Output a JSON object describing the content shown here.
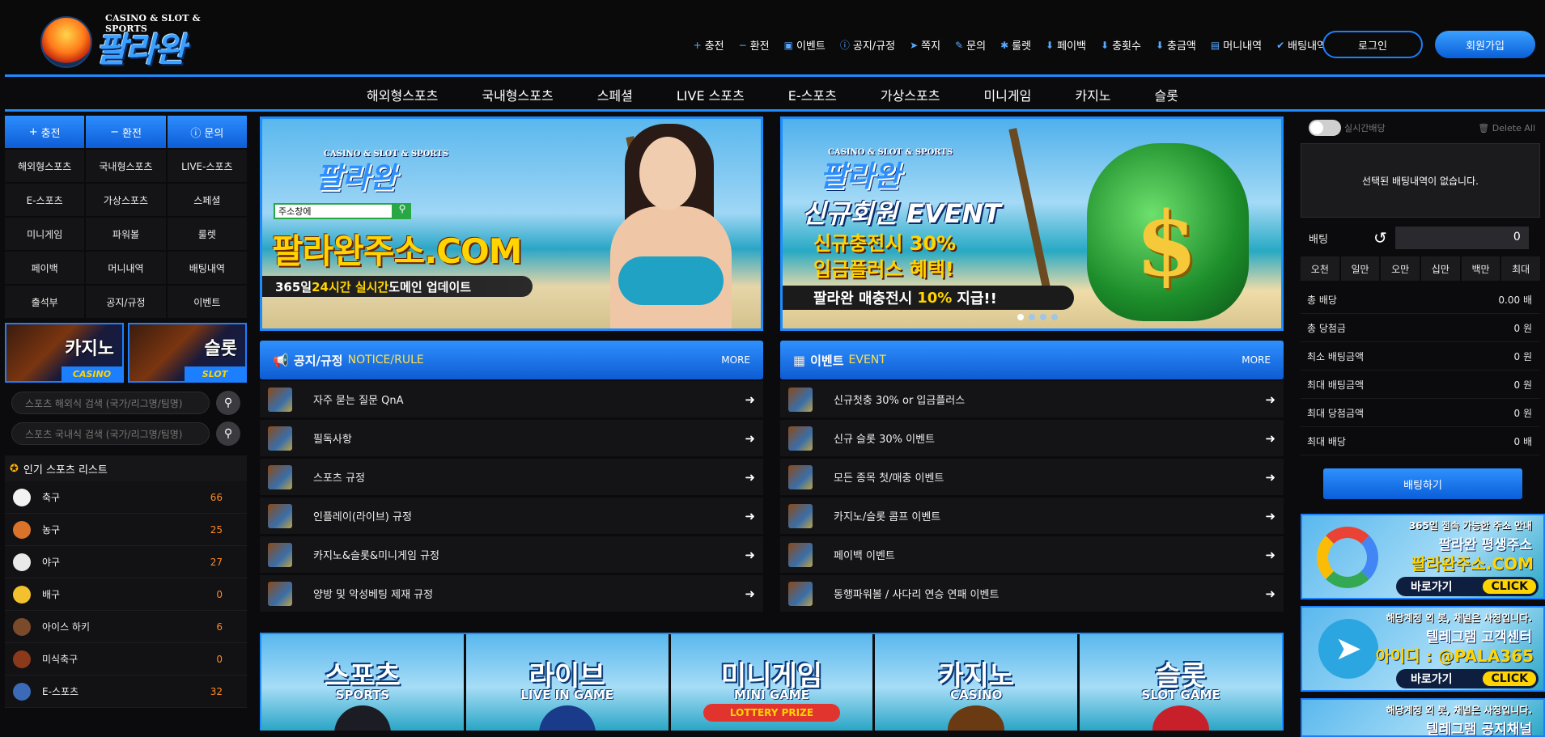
{
  "logo": {
    "small": "CASINO & SLOT & SPORTS",
    "big": "팔라완"
  },
  "topnav": [
    {
      "icon": "plus-icon",
      "glyph": "+",
      "label": "충전"
    },
    {
      "icon": "minus-icon",
      "glyph": "−",
      "label": "환전"
    },
    {
      "icon": "calendar-icon",
      "glyph": "▣",
      "label": "이벤트"
    },
    {
      "icon": "info-icon",
      "glyph": "ⓘ",
      "label": "공지/규정"
    },
    {
      "icon": "paper-plane-icon",
      "glyph": "➤",
      "label": "쪽지"
    },
    {
      "icon": "edit-icon",
      "glyph": "✎",
      "label": "문의"
    },
    {
      "icon": "gift-icon",
      "glyph": "✱",
      "label": "룰렛"
    },
    {
      "icon": "hand-coin-icon",
      "glyph": "⬇",
      "label": "페이백"
    },
    {
      "icon": "hand-coin-icon",
      "glyph": "⬇",
      "label": "충횟수"
    },
    {
      "icon": "hand-coin-icon",
      "glyph": "⬇",
      "label": "충금액"
    },
    {
      "icon": "wallet-icon",
      "glyph": "▤",
      "label": "머니내역"
    },
    {
      "icon": "check-icon",
      "glyph": "✔",
      "label": "배팅내역"
    }
  ],
  "auth": {
    "login": "로그인",
    "join": "회원가입"
  },
  "mainnav": [
    "해외형스포츠",
    "국내형스포츠",
    "스페셜",
    "LIVE 스포츠",
    "E-스포츠",
    "가상스포츠",
    "미니게임",
    "카지노",
    "슬롯"
  ],
  "sidebar": {
    "quick": [
      {
        "glyph": "+",
        "label": "충전"
      },
      {
        "glyph": "−",
        "label": "환전"
      },
      {
        "glyph": "ⓘ",
        "label": "문의"
      }
    ],
    "grid": [
      "해외형스포츠",
      "국내형스포츠",
      "LIVE-스포츠",
      "E-스포츠",
      "가상스포츠",
      "스페셜",
      "미니게임",
      "파워볼",
      "룰렛",
      "페이백",
      "머니내역",
      "배팅내역",
      "출석부",
      "공지/규정",
      "이벤트"
    ],
    "tiles": [
      {
        "title": "카지노",
        "tag": "CASINO"
      },
      {
        "title": "슬롯",
        "tag": "SLOT"
      }
    ],
    "search_overseas": "스포츠 해외식 검색 (국가/리그명/팀명)",
    "search_domestic": "스포츠 국내식 검색 (국가/리그명/팀명)",
    "popular_title": "인기 스포츠 리스트",
    "sports": [
      {
        "name": "축구",
        "count": "66",
        "color": "#f2f2f2"
      },
      {
        "name": "농구",
        "count": "25",
        "color": "#d9732a"
      },
      {
        "name": "야구",
        "count": "27",
        "color": "#e9e9e9"
      },
      {
        "name": "배구",
        "count": "0",
        "color": "#f3c02e"
      },
      {
        "name": "아이스 하키",
        "count": "6",
        "color": "#7a4a2a"
      },
      {
        "name": "미식축구",
        "count": "0",
        "color": "#8a3a1a"
      },
      {
        "name": "E-스포츠",
        "count": "32",
        "color": "#3a6ab8"
      }
    ]
  },
  "banner1": {
    "logo_small": "CASINO & SLOT & SPORTS",
    "logo_big": "팔라완",
    "addr": "주소창에",
    "site": "팔라완주소.COM",
    "strip_a": "365일 ",
    "strip_b": "24시간 실시간",
    "strip_c": " 도메인 업데이트"
  },
  "banner2": {
    "logo_small": "CASINO & SLOT & SPORTS",
    "logo_big": "팔라완",
    "event": "신규회원 EVENT",
    "line1": "신규충전시 30%",
    "line2": "입금플러스 혜택!",
    "strip_a": "팔라완 매충전시",
    "strip_b": "10%",
    "strip_c": "지급!!"
  },
  "notice": {
    "title": "공지/규정",
    "sub": "NOTICE/RULE",
    "more": "MORE",
    "items": [
      "자주 묻는 질문 QnA",
      "필독사항",
      "스포츠 규정",
      "인플레이(라이브) 규정",
      "카지노&슬롯&미니게임 규정",
      "양방 및 악성베팅 제재 규정"
    ]
  },
  "event": {
    "title": "이벤트",
    "sub": "EVENT",
    "more": "MORE",
    "items": [
      "신규첫충 30% or 입금플러스",
      "신규 슬롯 30% 이벤트",
      "모든 종목 첫/매충 이벤트",
      "카지노/슬롯 콤프 이벤트",
      "페이백 이벤트",
      "동행파워볼 / 사다리 연승 연패 이벤트"
    ]
  },
  "games": [
    {
      "kr": "스포츠",
      "en": "SPORTS"
    },
    {
      "kr": "라이브",
      "en": "LIVE IN GAME"
    },
    {
      "kr": "미니게임",
      "en": "MINI GAME",
      "extra": "LOTTERY PRIZE"
    },
    {
      "kr": "카지노",
      "en": "CASINO"
    },
    {
      "kr": "슬롯",
      "en": "SLOT GAME"
    }
  ],
  "betslip": {
    "realtime": "실시간배당",
    "delete_all": "Delete All",
    "empty": "선택된 배팅내역이 없습니다.",
    "bet_label": "배팅",
    "bet_value": "0",
    "amounts": [
      "오천",
      "일만",
      "오만",
      "십만",
      "백만",
      "최대"
    ],
    "stats": [
      {
        "k": "총 배당",
        "v": "0.00 배"
      },
      {
        "k": "총 당첨금",
        "v": "0 원"
      },
      {
        "k": "최소 배팅금액",
        "v": "0 원"
      },
      {
        "k": "최대 배팅금액",
        "v": "0 원"
      },
      {
        "k": "최대 당첨금액",
        "v": "0 원"
      },
      {
        "k": "최대 배당",
        "v": "0 배"
      }
    ],
    "bet_button": "배팅하기"
  },
  "ads": [
    {
      "l1": "365일 접속 가능한 주소 안내",
      "l2": "팔라완 평생주소",
      "l3": "팔라완주소.COM",
      "go": "바로가기",
      "click": "CLICK"
    },
    {
      "l1": "해당계정 외 봇, 채널은 사칭입니다.",
      "l2": "텔레그램 고객센터",
      "l3": "아이디 : @PALA365",
      "go": "바로가기",
      "click": "CLICK"
    },
    {
      "l1": "해당계정 외 봇, 채널은 사칭입니다.",
      "l2": "텔레그램 공지채널"
    }
  ]
}
